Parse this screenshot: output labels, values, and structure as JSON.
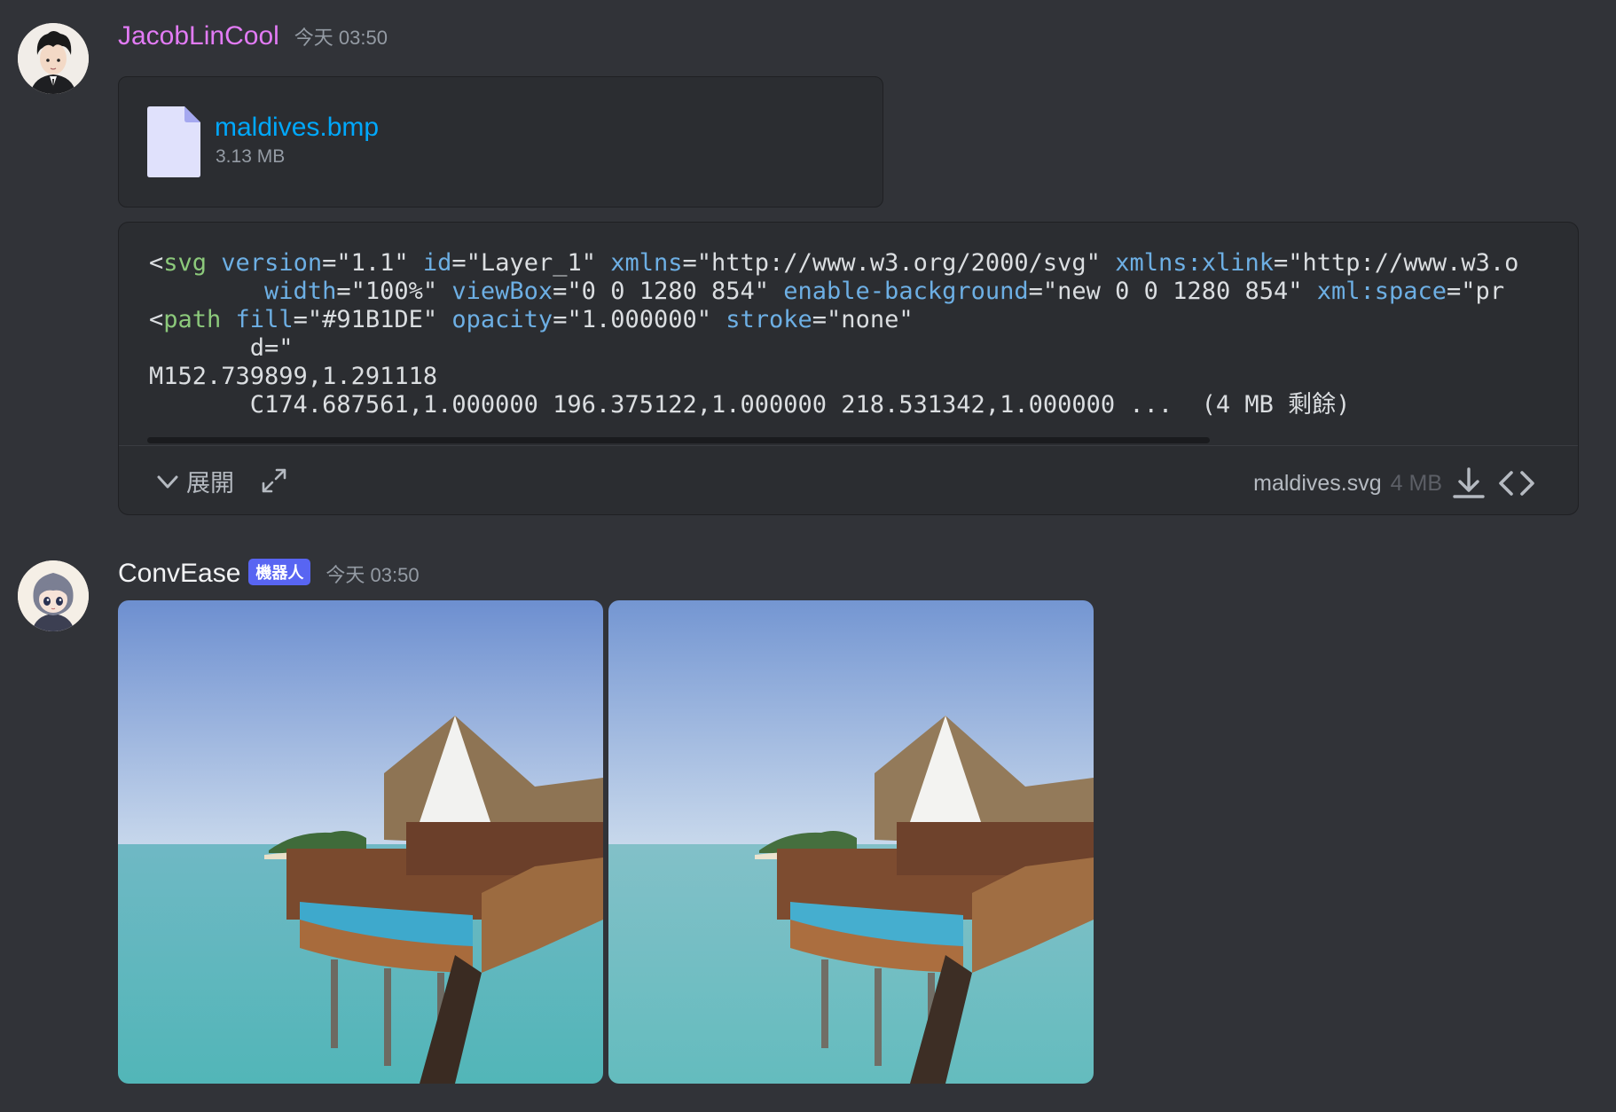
{
  "messages": [
    {
      "author": "JacobLinCool",
      "timestamp": "今天 03:50",
      "attachment": {
        "file_name": "maldives.bmp",
        "file_size": "3.13 MB"
      },
      "code_preview": {
        "lines": [
          [
            [
              "<",
              "st"
            ],
            [
              "svg",
              "tg"
            ],
            [
              " version",
              "at"
            ],
            [
              "=\"1.1\"",
              "st"
            ],
            [
              " id",
              "at"
            ],
            [
              "=\"Layer_1\"",
              "st"
            ],
            [
              " xmlns",
              "at"
            ],
            [
              "=\"http://www.w3.org/2000/svg\"",
              "st"
            ],
            [
              " xmlns:xlink",
              "at"
            ],
            [
              "=\"http://www.w3.o",
              "st"
            ]
          ],
          [
            [
              "        width",
              "at"
            ],
            [
              "=\"100%\"",
              "st"
            ],
            [
              " viewBox",
              "at"
            ],
            [
              "=\"0 0 1280 854\"",
              "st"
            ],
            [
              " enable-background",
              "at"
            ],
            [
              "=\"new 0 0 1280 854\"",
              "st"
            ],
            [
              " xml:space",
              "at"
            ],
            [
              "=\"pr",
              "st"
            ]
          ],
          [
            [
              "<",
              "st"
            ],
            [
              "path",
              "tg"
            ],
            [
              " fill",
              "at"
            ],
            [
              "=\"#91B1DE\"",
              "st"
            ],
            [
              " opacity",
              "at"
            ],
            [
              "=\"1.000000\"",
              "st"
            ],
            [
              " stroke",
              "at"
            ],
            [
              "=\"none\"",
              "st"
            ]
          ],
          [
            [
              "       d=\"",
              "st"
            ]
          ],
          [
            [
              "M152.739899,1.291118",
              "st"
            ]
          ],
          [
            [
              "       C174.687561,1.000000 196.375122,1.000000 218.531342,1.000000 ...  (4 MB 剩餘)",
              "st"
            ]
          ]
        ],
        "expand_label": "展開",
        "file_name": "maldives.svg",
        "file_size": "4 MB"
      }
    },
    {
      "author": "ConvEase",
      "badge": "機器人",
      "timestamp": "今天 03:50",
      "images": [
        "maldives-original",
        "maldives-converted"
      ]
    }
  ],
  "icons": {
    "file": "file-icon",
    "expand": "chevron-down-icon",
    "fullscreen": "expand-arrows-icon",
    "download": "download-icon",
    "code": "code-brackets-icon"
  },
  "colors": {
    "background": "#313338",
    "card": "#2b2d31",
    "link": "#00a8fc",
    "user1": "#e27bf5",
    "bot_badge": "#5865f2"
  }
}
